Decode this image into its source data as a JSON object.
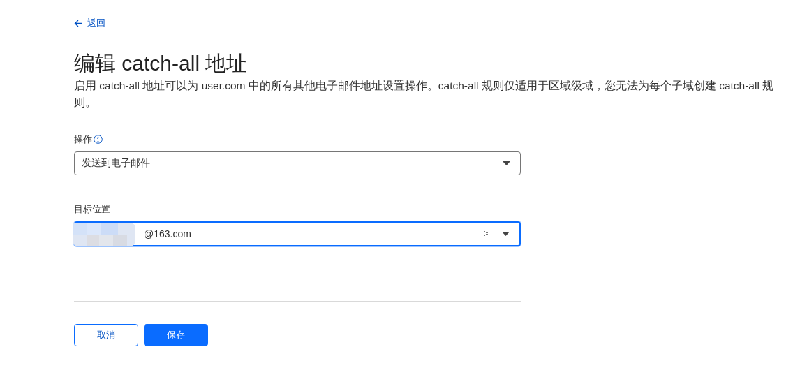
{
  "back_link": {
    "label": "返回"
  },
  "title": "编辑 catch-all 地址",
  "description": "启用 catch-all 地址可以为 user.com 中的所有其他电子邮件地址设置操作。catch-all 规则仅适用于区域级域，您无法为每个子域创建 catch-all 规则。",
  "action_field": {
    "label": "操作",
    "value": "发送到电子邮件"
  },
  "destination_field": {
    "label": "目标位置",
    "value": "@163.com",
    "focused": true,
    "redacted": true
  },
  "buttons": [
    {
      "label": "取消",
      "kind": "secondary"
    },
    {
      "label": "保存",
      "kind": "primary"
    }
  ]
}
